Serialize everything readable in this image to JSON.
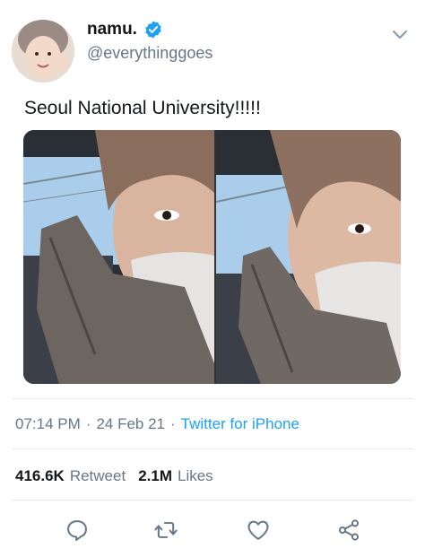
{
  "user": {
    "display_name": "namu.",
    "handle": "@everythinggoes",
    "verified": true
  },
  "icons": {
    "verified": "verified-badge-icon",
    "more": "chevron-down-icon",
    "reply": "reply-icon",
    "retweet": "retweet-icon",
    "like": "heart-icon",
    "share": "share-icon"
  },
  "tweet": {
    "text": "Seoul National University!!!!!",
    "time": "07:14 PM",
    "date": "24 Feb 21",
    "source": "Twitter for iPhone",
    "separator": "·"
  },
  "stats": {
    "retweets": "416.6K",
    "retweets_label": "Retweet",
    "likes": "2.1M",
    "likes_label": "Likes"
  },
  "colors": {
    "accent": "#1da1f2",
    "secondary_text": "#657786",
    "divider": "#e6ecf0",
    "icon": "#657786"
  }
}
